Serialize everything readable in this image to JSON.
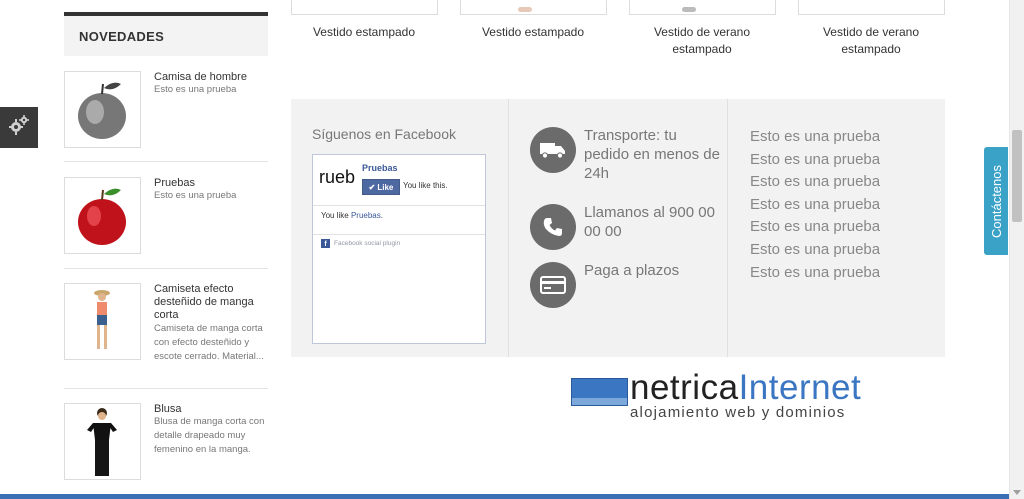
{
  "sidebar": {
    "heading": "NOVEDADES",
    "products": [
      {
        "title": "Camisa de hombre",
        "desc": "Esto es una prueba"
      },
      {
        "title": "Pruebas",
        "desc": "Esto es una prueba"
      },
      {
        "title": "Camiseta efecto desteñido de manga corta",
        "desc": "Camiseta de manga corta con efecto desteñido y escote cerrado. Material..."
      },
      {
        "title": "Blusa",
        "desc": "Blusa de manga corta con detalle drapeado muy femenino en la manga."
      }
    ]
  },
  "top_products": [
    {
      "label": "Vestido estampado"
    },
    {
      "label": "Vestido estampado"
    },
    {
      "label": "Vestido de verano estampado"
    },
    {
      "label": "Vestido de verano estampado"
    }
  ],
  "footer": {
    "facebook": {
      "title": "Síguenos en Facebook",
      "page_logo": "rueb",
      "page_name": "Pruebas",
      "like_button": "Like",
      "you_like": "You like this.",
      "you_like_prefix": "You like ",
      "you_like_page": "Pruebas",
      "you_like_suffix": ".",
      "plugin_label": "Facebook social plugin"
    },
    "info": [
      {
        "icon": "truck-icon",
        "text": "Transporte: tu pedido en menos de 24h"
      },
      {
        "icon": "phone-icon",
        "text": "Llamanos al 900 00 00 00"
      },
      {
        "icon": "credit-card-icon",
        "text": "Paga a plazos"
      }
    ],
    "links": [
      "Esto es una prueba",
      "Esto es una prueba",
      "Esto es una prueba",
      "Esto es una prueba",
      "Esto es una prueba",
      "Esto es una prueba",
      "Esto es una prueba"
    ]
  },
  "contact_tab": "Contáctenos",
  "brand": {
    "name_part1": "netrica",
    "name_part2": "Internet",
    "tagline": "alojamiento web y dominios"
  },
  "colors": {
    "accent": "#3aa1c7",
    "brand_blue": "#3a76c2",
    "panel_bg": "#f2f2f2",
    "icon_bg": "#6b6b6b"
  }
}
